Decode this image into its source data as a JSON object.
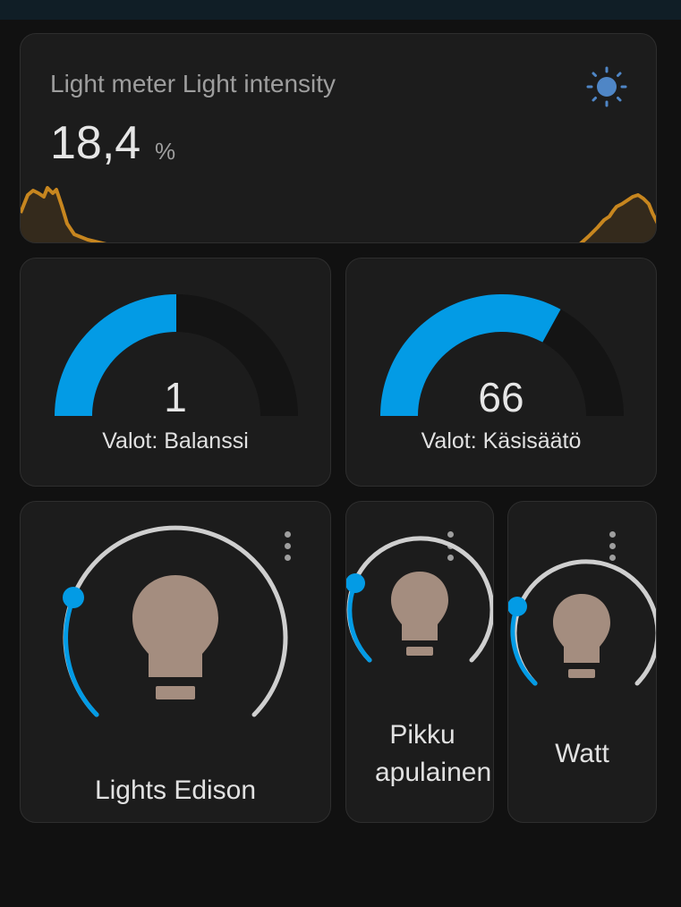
{
  "sensor": {
    "title": "Light meter Light intensity",
    "value": "18,4",
    "unit": "%",
    "icon": "sun-icon",
    "line_color": "#c7861f"
  },
  "gauges": [
    {
      "label": "Valot: Balanssi",
      "value": "1",
      "fraction": 0.5
    },
    {
      "label": "Valot: Käsisäätö",
      "value": "66",
      "fraction": 0.66
    }
  ],
  "lights": [
    {
      "name": "Lights Edison",
      "brightness_fraction": 0.05,
      "icon": "lightbulb-icon"
    },
    {
      "name_line1": "Pikku",
      "name_line2": "apulainen",
      "brightness_fraction": 0.05,
      "icon": "lightbulb-icon"
    },
    {
      "name": "Watt",
      "brightness_fraction": 0.05,
      "icon": "lightbulb-icon"
    }
  ],
  "colors": {
    "accent": "#039be5",
    "gauge_track": "#141414",
    "bulb": "#a48d7f",
    "slider_track": "#cfcfcf"
  }
}
